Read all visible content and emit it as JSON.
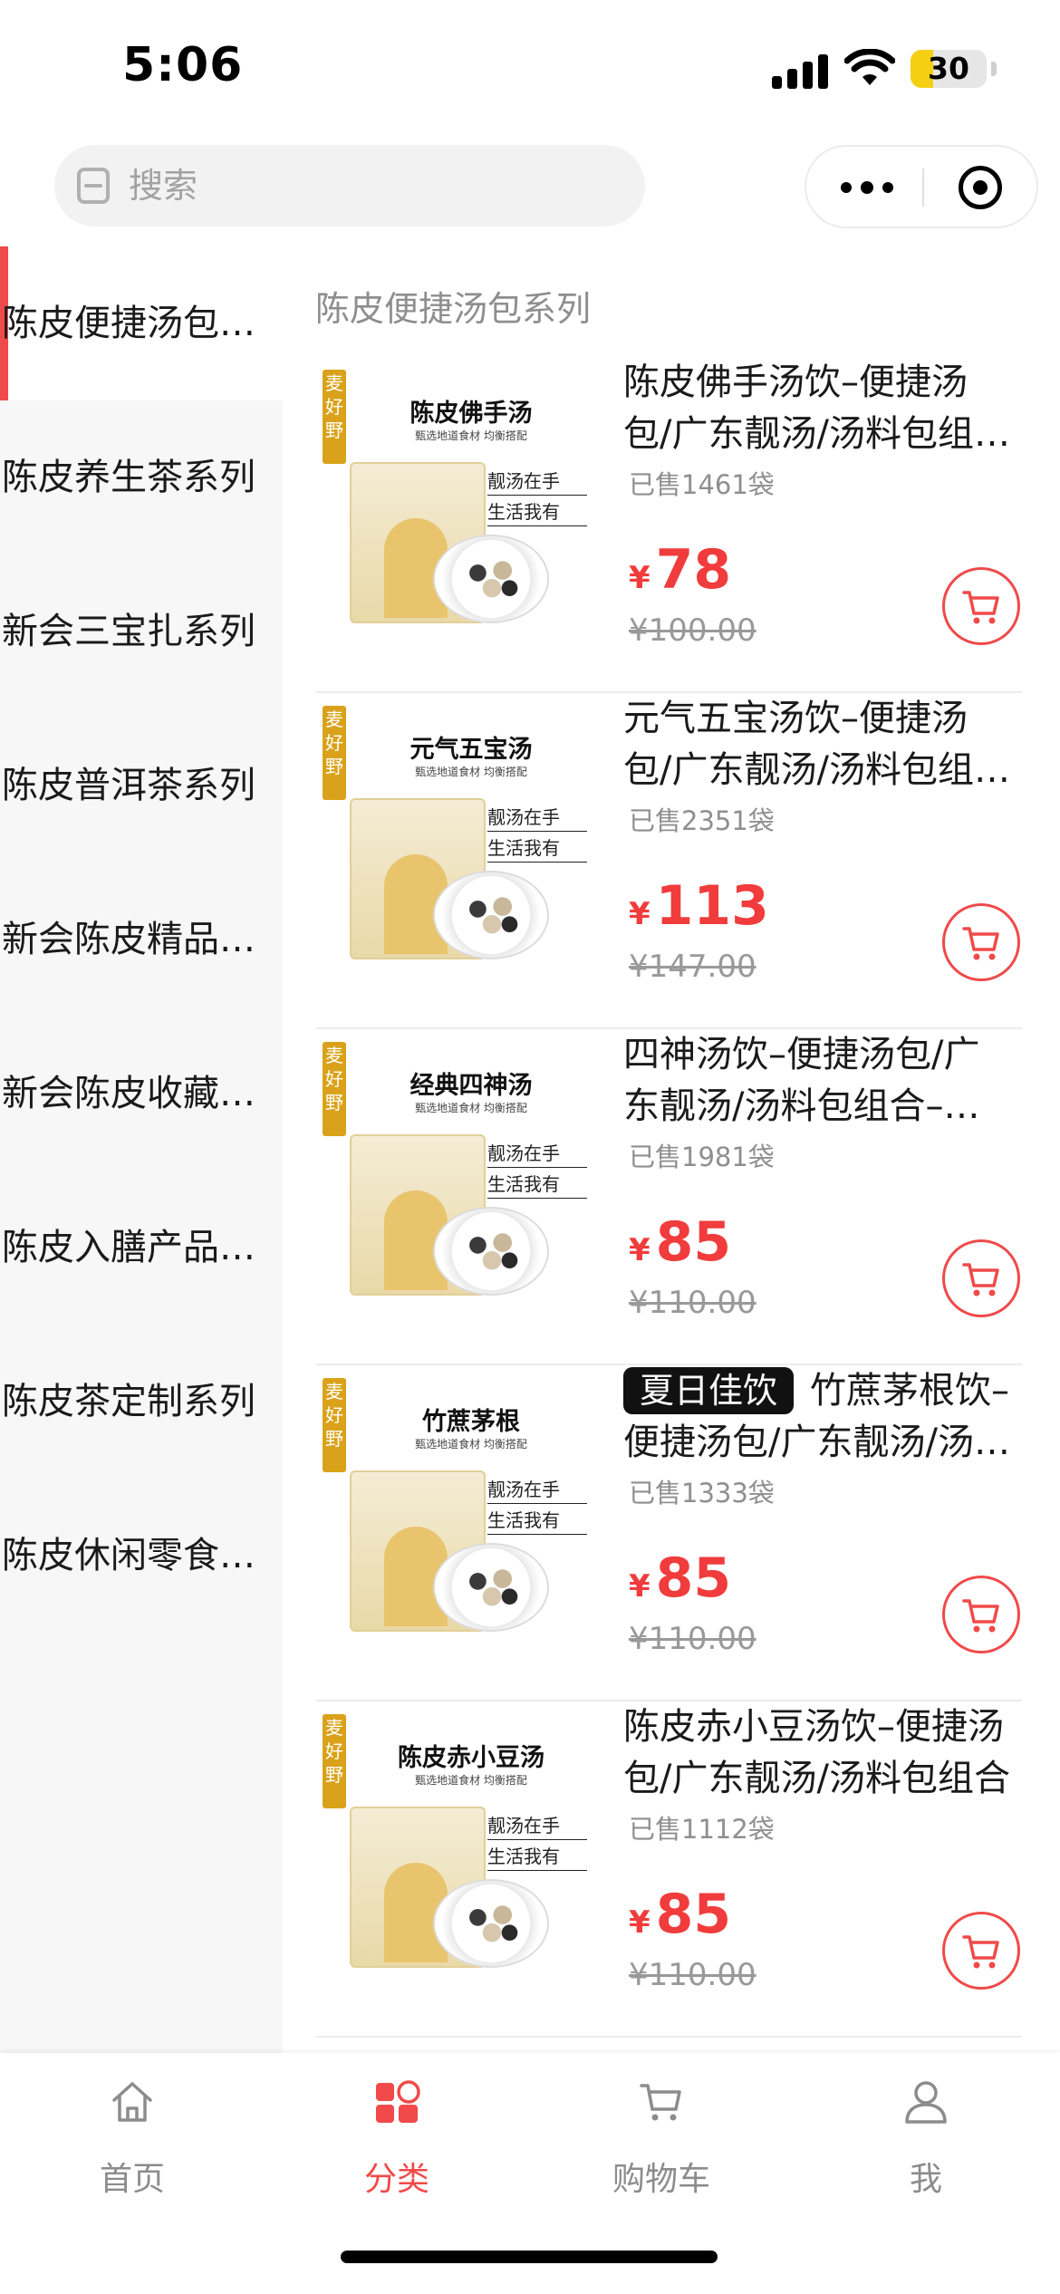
{
  "status_bar": {
    "time": "5:06",
    "battery": "30",
    "battery_level": 0.3
  },
  "header": {
    "search_placeholder": "搜索"
  },
  "sidebar": {
    "items": [
      {
        "label": "陈皮便捷汤包系列",
        "active": true
      },
      {
        "label": "陈皮养生茶系列",
        "active": false
      },
      {
        "label": "新会三宝扎系列",
        "active": false
      },
      {
        "label": "陈皮普洱茶系列",
        "active": false
      },
      {
        "label": "新会陈皮精品系列",
        "active": false
      },
      {
        "label": "新会陈皮收藏系列",
        "active": false
      },
      {
        "label": "陈皮入膳产品系列",
        "active": false
      },
      {
        "label": "陈皮茶定制系列",
        "active": false
      },
      {
        "label": "陈皮休闲零食系列",
        "active": false
      }
    ]
  },
  "section_title": "陈皮便捷汤包系列",
  "products": [
    {
      "badge": "",
      "title": "陈皮佛手汤饮–便捷汤包/广东靓汤/汤料包组合–麦好野",
      "sold": "已售1461袋",
      "yen": "¥",
      "price": "78",
      "original_price": "¥100.00",
      "thumb": {
        "brand": "麦好野",
        "name": "陈皮佛手汤",
        "sub": "甄选地道食材 均衡搭配",
        "slogan1": "靓汤在手",
        "slogan2": "生活我有"
      }
    },
    {
      "badge": "",
      "title": "元气五宝汤饮–便捷汤包/广东靓汤/汤料包组合–麦好野",
      "sold": "已售2351袋",
      "yen": "¥",
      "price": "113",
      "original_price": "¥147.00",
      "thumb": {
        "brand": "麦好野",
        "name": "元气五宝汤",
        "sub": "甄选地道食材 均衡搭配",
        "slogan1": "靓汤在手",
        "slogan2": "生活我有"
      }
    },
    {
      "badge": "",
      "title": "四神汤饮–便捷汤包/广东靓汤/汤料包组合–麦好野",
      "sold": "已售1981袋",
      "yen": "¥",
      "price": "85",
      "original_price": "¥110.00",
      "thumb": {
        "brand": "麦好野",
        "name": "经典四神汤",
        "sub": "甄选地道食材 均衡搭配",
        "slogan1": "靓汤在手",
        "slogan2": "生活我有"
      }
    },
    {
      "badge": "夏日佳饮",
      "title": "竹蔗茅根饮–便捷汤包/广东靓汤/汤料包组合",
      "sold": "已售1333袋",
      "yen": "¥",
      "price": "85",
      "original_price": "¥110.00",
      "thumb": {
        "brand": "麦好野",
        "name": "竹蔗茅根",
        "sub": "甄选地道食材 均衡搭配",
        "slogan1": "靓汤在手",
        "slogan2": "生活我有"
      }
    },
    {
      "badge": "",
      "title": "陈皮赤小豆汤饮–便捷汤包/广东靓汤/汤料包组合",
      "sold": "已售1112袋",
      "yen": "¥",
      "price": "85",
      "original_price": "¥110.00",
      "thumb": {
        "brand": "麦好野",
        "name": "陈皮赤小豆汤",
        "sub": "甄选地道食材 均衡搭配",
        "slogan1": "靓汤在手",
        "slogan2": "生活我有"
      }
    }
  ],
  "tabbar": {
    "items": [
      {
        "label": "首页",
        "icon": "home-icon",
        "active": false
      },
      {
        "label": "分类",
        "icon": "category-icon",
        "active": true
      },
      {
        "label": "购物车",
        "icon": "cart-icon",
        "active": false
      },
      {
        "label": "我",
        "icon": "user-icon",
        "active": false
      }
    ]
  },
  "colors": {
    "accent": "#f04a4a",
    "price": "#f03c3c",
    "sidebar_bg": "#f7f7f7",
    "battery": "#f5cf14"
  }
}
